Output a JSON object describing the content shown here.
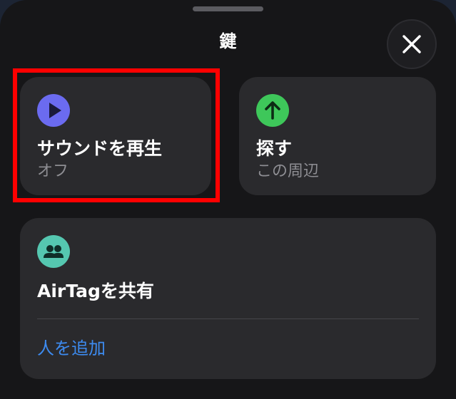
{
  "sheet": {
    "title": "鍵",
    "close_icon": "close-icon"
  },
  "actions": {
    "play_sound": {
      "label": "サウンドを再生",
      "status": "オフ",
      "icon": "play-icon",
      "icon_color": "#6b6bf0"
    },
    "find": {
      "label": "探す",
      "status": "この周辺",
      "icon": "arrow-up-icon",
      "icon_color": "#3ec75a"
    }
  },
  "share": {
    "label": "AirTagを共有",
    "icon": "people-icon",
    "icon_color": "#55c7b0",
    "add_person_label": "人を追加",
    "add_person_color": "#3d8bf0"
  },
  "annotation": {
    "highlight_color": "#ff0000"
  }
}
